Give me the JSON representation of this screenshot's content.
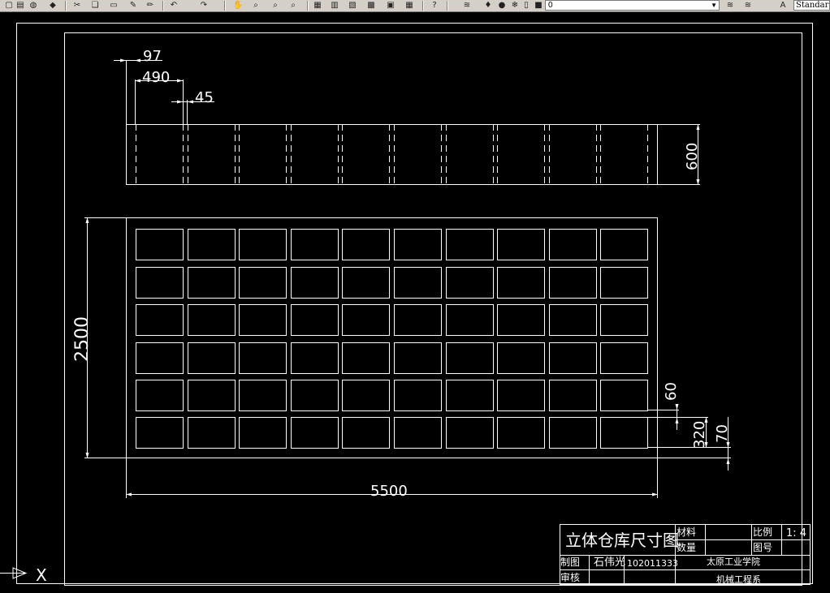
{
  "toolbar": {
    "icons": [
      "new-icon",
      "open-icon",
      "save-icon",
      "plot-icon",
      "cut-icon",
      "copy-icon",
      "paste-icon",
      "match-properties-icon",
      "brush-icon",
      "undo-icon",
      "redo-icon",
      "pan-icon",
      "zoom-realtime-icon",
      "zoom-window-icon",
      "zoom-previous-icon",
      "properties-icon",
      "design-center-icon",
      "tool-palette-icon",
      "sheet-set-icon",
      "markup-icon",
      "calculator-icon",
      "help-icon",
      "layer-manager-icon",
      "lightbulb-icon",
      "sun-icon",
      "freeze-icon",
      "lock-icon",
      "color-swatch-icon"
    ],
    "layer_value": "0",
    "style_value": "Standard"
  },
  "drawing": {
    "dimensions": {
      "gap": "97",
      "cell_width": "490",
      "post_width": "45",
      "side_height": "600",
      "total_height": "2500",
      "total_length": "5500",
      "row_spacing": "60",
      "cell_height": "320",
      "base_offset": "70"
    },
    "title_block": {
      "drawing_title": "立体仓库尺寸图",
      "material_label": "材料",
      "quantity_label": "数量",
      "scale_label": "比例",
      "scale_value": "1: 4",
      "drawing_no_label": "图号",
      "drafter_label": "制图",
      "drafter_name": "石伟光",
      "student_id": "102011333",
      "reviewer_label": "审核",
      "school": "太原工业学院",
      "department": "机械工程系"
    },
    "grid": {
      "rows": 6,
      "cols": 10
    },
    "ucs_axis_label": "X"
  }
}
